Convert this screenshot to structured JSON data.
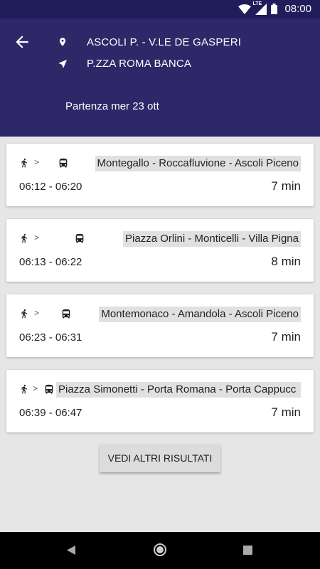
{
  "status_bar": {
    "time": "08:00",
    "network_label": "LTE"
  },
  "header": {
    "from": "ASCOLI P. - V.LE DE GASPERI",
    "to": "P.ZZA ROMA BANCA",
    "departure": "Partenza mer 23 ott"
  },
  "results": [
    {
      "line": "Montegallo - Roccafluvione - Ascoli Piceno",
      "times": "06:12 - 06:20",
      "duration": "7 min"
    },
    {
      "line": "Piazza Orlini - Monticelli - Villa Pigna",
      "times": "06:13 - 06:22",
      "duration": "8 min"
    },
    {
      "line": "Montemonaco - Amandola - Ascoli Piceno",
      "times": "06:23 - 06:31",
      "duration": "7 min"
    },
    {
      "line": "Piazza Simonetti - Porta Romana - Porta Cappucc",
      "times": "06:39 - 06:47",
      "duration": "7 min"
    }
  ],
  "arrow_glyph": ">",
  "more_button": "VEDI ALTRI RISULTATI",
  "icons": {
    "back": "arrow-left-icon",
    "from": "location-pin-icon",
    "to": "navigation-arrow-icon",
    "walk": "walk-icon",
    "bus": "bus-icon"
  },
  "colors": {
    "status_bar": "#211c5a",
    "header": "#2e2768",
    "background": "#e6e6e6",
    "card": "#ffffff",
    "line_chip": "#e0e0e0"
  }
}
